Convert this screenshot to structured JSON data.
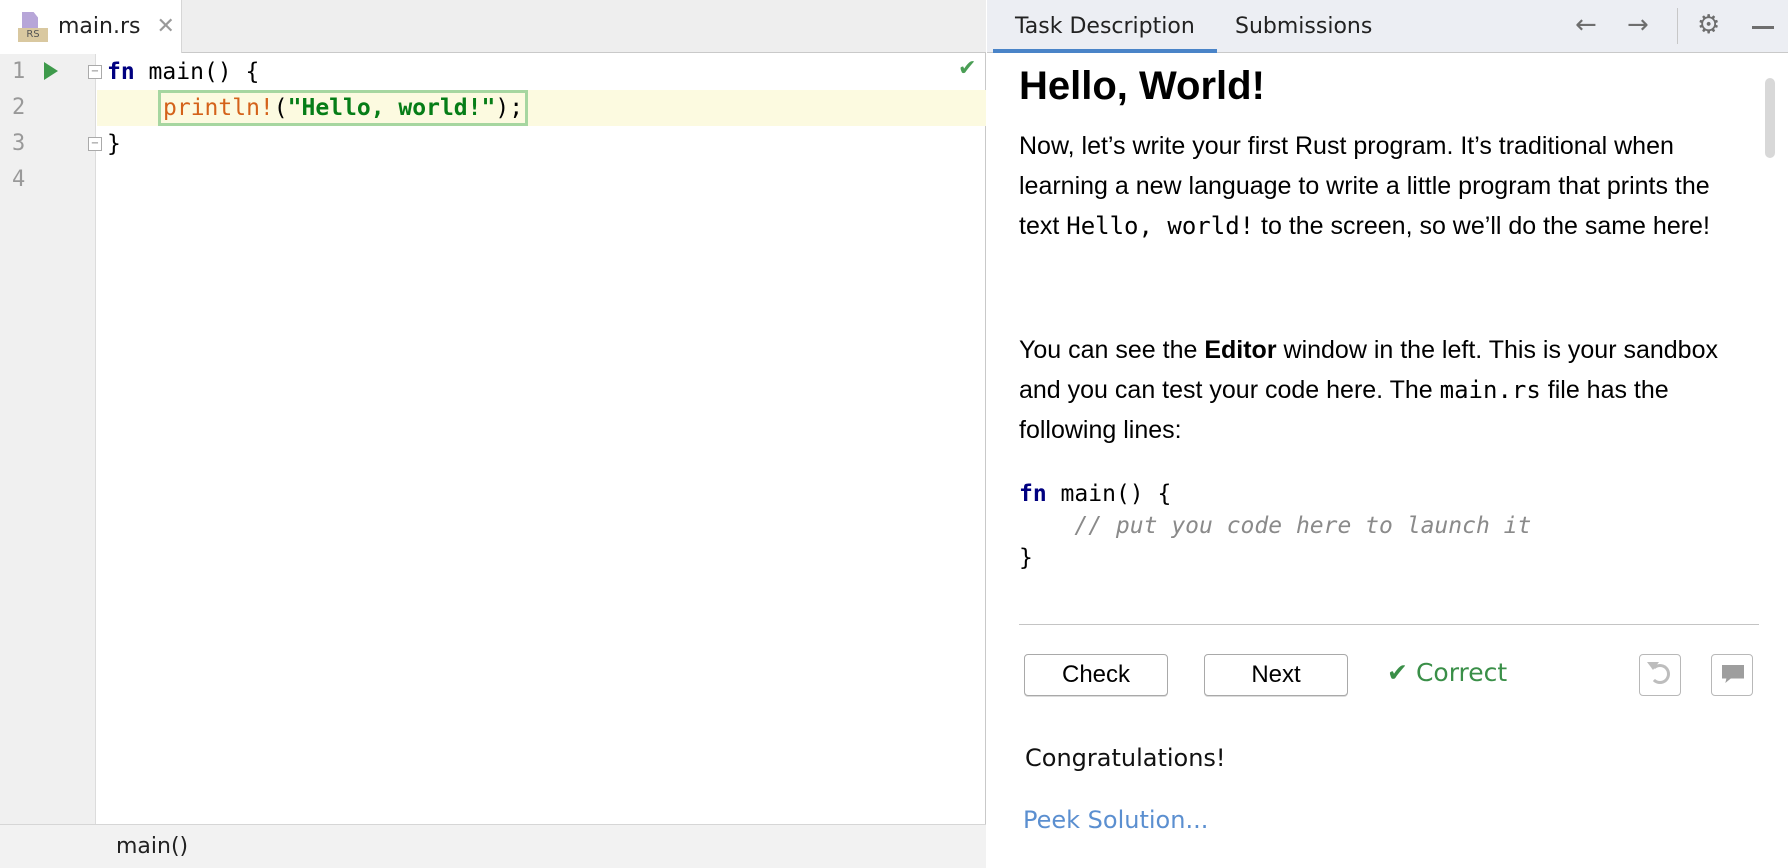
{
  "editor": {
    "tab": {
      "icon_label": "RS",
      "filename": "main.rs",
      "close": "✕"
    },
    "lines": [
      {
        "number": "1"
      },
      {
        "number": "2"
      },
      {
        "number": "3"
      },
      {
        "number": "4"
      }
    ],
    "code": {
      "line1_kw": "fn",
      "line1_rest": " main() {",
      "line2_macro": "println!",
      "line2_open": "(",
      "line2_str": "\"Hello, world!\"",
      "line2_close": ");",
      "line3": "}"
    },
    "check_icon": "✔",
    "breadcrumb": "main()"
  },
  "task_panel": {
    "tabs": [
      {
        "label": "Task Description"
      },
      {
        "label": "Submissions"
      }
    ],
    "toolbar_icons": {
      "back": "←",
      "forward": "→",
      "settings": "⚙"
    },
    "title": "Hello, World!",
    "paragraph1": {
      "before": "Now, let’s write your first Rust program. It’s traditional when learning a new language to write a little program that prints the text ",
      "code": "Hello, world!",
      "after": " to the screen, so we’ll do the same here!"
    },
    "paragraph2": {
      "before": "You can see the ",
      "bold": "Editor",
      "middle": " window in the left. This is your sandbox and you can test your code here. The ",
      "code": "main.rs",
      "after": " file has the following lines:"
    },
    "code_block": {
      "kw": "fn",
      "line1_rest": " main() {",
      "comment": "    // put you code here to launch it",
      "line3": "}"
    },
    "buttons": {
      "check": "Check",
      "next": "Next"
    },
    "status": {
      "icon": "✔",
      "text": "Correct"
    },
    "congrats": "Congratulations!",
    "peek_solution": "Peek Solution..."
  },
  "colors": {
    "accent_tab": "#4a84c8",
    "correct_green": "#3a8f48",
    "link_blue": "#5b8fd0",
    "current_line": "#fcfae0"
  }
}
